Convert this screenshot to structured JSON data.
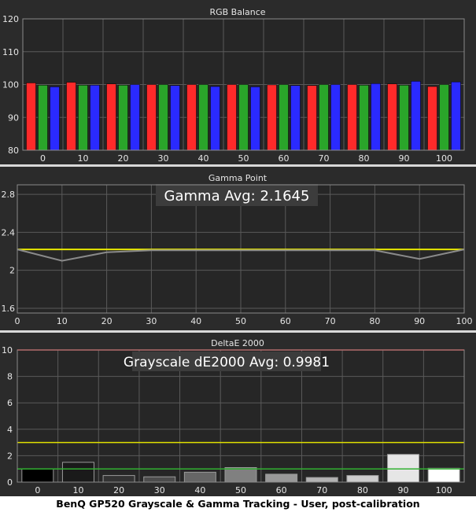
{
  "caption": "BenQ GP520 Grayscale & Gamma Tracking - User, post-calibration",
  "colors": {
    "background": "#2b2b2b",
    "plot_background": "#262626",
    "grid": "#5a5a5a",
    "text": "#e6e6e6",
    "red": "#ff2a2a",
    "green": "#2aa52a",
    "blue": "#2a2aff",
    "gamma_line": "#8a8a8a",
    "gamma_target": "#e8e800",
    "delta_red_line": "#ff3030",
    "delta_yellow_line": "#e0e000",
    "delta_green_line": "#30b030"
  },
  "chart_data": [
    {
      "type": "bar",
      "title": "RGB Balance",
      "categories": [
        "0",
        "10",
        "20",
        "30",
        "40",
        "50",
        "60",
        "70",
        "80",
        "90",
        "100"
      ],
      "ylim": [
        80,
        120
      ],
      "yticks": [
        80,
        90,
        100,
        110,
        120
      ],
      "grid": true,
      "series": [
        {
          "values": [
            100.5,
            100.7,
            100.2,
            100.0,
            100.0,
            100.0,
            99.9,
            99.7,
            100.0,
            100.2,
            99.4
          ]
        },
        {
          "values": [
            99.8,
            99.8,
            99.8,
            100.0,
            100.0,
            100.0,
            100.0,
            100.0,
            99.8,
            99.8,
            100.0
          ]
        },
        {
          "values": [
            99.3,
            99.8,
            100.0,
            99.7,
            99.4,
            99.3,
            99.7,
            100.0,
            100.3,
            101.0,
            100.8
          ]
        }
      ]
    },
    {
      "type": "line",
      "title": "Gamma Point",
      "annotation": "Gamma Avg: 2.1645",
      "x": [
        0,
        10,
        20,
        30,
        40,
        50,
        60,
        70,
        80,
        90,
        100
      ],
      "xticks": [
        0,
        10,
        20,
        30,
        40,
        50,
        60,
        70,
        80,
        90,
        100
      ],
      "ylim": [
        1.55,
        2.9
      ],
      "yticks": [
        1.6,
        2,
        2.4,
        2.8
      ],
      "grid": true,
      "series": [
        {
          "values": [
            2.22,
            2.1,
            2.19,
            2.21,
            2.21,
            2.21,
            2.21,
            2.21,
            2.21,
            2.12,
            2.22
          ]
        },
        {
          "values": [
            2.22,
            2.22,
            2.22,
            2.22,
            2.22,
            2.22,
            2.22,
            2.22,
            2.22,
            2.22,
            2.22
          ]
        }
      ]
    },
    {
      "type": "bar",
      "title": "DeltaE 2000",
      "annotation": "Grayscale dE2000 Avg: 0.9981",
      "categories": [
        "0",
        "10",
        "20",
        "30",
        "40",
        "50",
        "60",
        "70",
        "80",
        "90",
        "100"
      ],
      "values": [
        1.0,
        1.5,
        0.5,
        0.4,
        0.75,
        1.1,
        0.6,
        0.35,
        0.5,
        2.1,
        1.05
      ],
      "ylim": [
        0,
        10
      ],
      "yticks": [
        0,
        2,
        4,
        6,
        8,
        10
      ],
      "reference_lines": [
        10,
        3,
        1
      ],
      "grid": true
    }
  ]
}
